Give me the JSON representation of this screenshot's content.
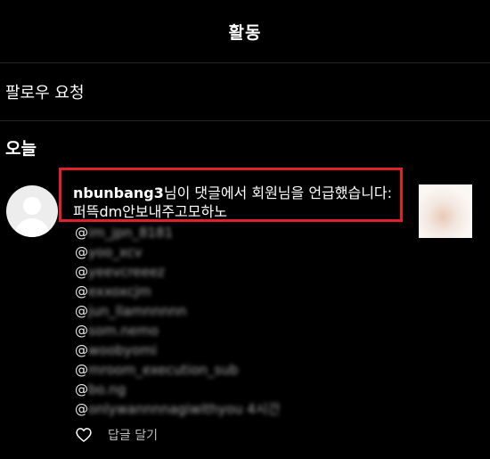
{
  "header": {
    "title": "활동"
  },
  "follow_requests": {
    "label": "팔로우 요청"
  },
  "section": {
    "title": "오늘"
  },
  "notification": {
    "username": "nbunbang3",
    "message": "님이 댓글에서 회원님을 언급했습니다: 퍼뜩dm안보내주고모하노",
    "mentions": [
      {
        "at": "@",
        "handle": "im_jpn_8181"
      },
      {
        "at": "@",
        "handle": "yoo_xcv"
      },
      {
        "at": "@",
        "handle": "yeevcreeez"
      },
      {
        "at": "@",
        "handle": "exxoxcjm"
      },
      {
        "at": "@",
        "handle": "jun_llamnnnnn"
      },
      {
        "at": "@",
        "handle": "som.nemo"
      },
      {
        "at": "@",
        "handle": "woobyomi"
      },
      {
        "at": "@",
        "handle": "mroom_execution_sub"
      },
      {
        "at": "@",
        "handle": "bo.ng"
      },
      {
        "at": "@",
        "handle": "onlywannnnagiwithyou 4시간"
      }
    ]
  },
  "actions": {
    "reply_label": "답글 달기"
  }
}
